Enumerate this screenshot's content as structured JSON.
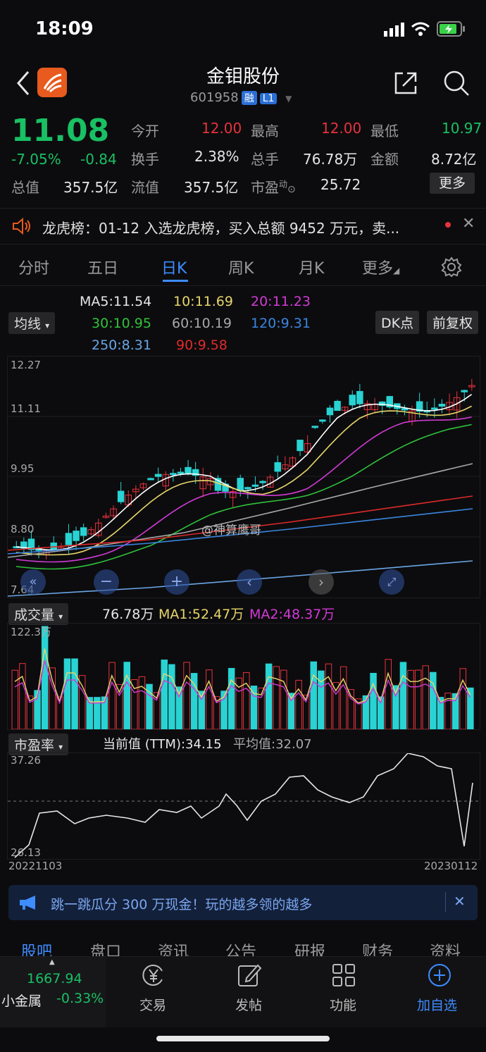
{
  "status_bar": {
    "time": "18:09"
  },
  "header": {
    "title": "金钼股份",
    "code": "601958",
    "tag_rong": "融",
    "tag_l1": "L1"
  },
  "quote": {
    "price": "11.08",
    "change_pct": "-7.05%",
    "change": "-0.84",
    "rows": [
      [
        {
          "label": "今开",
          "value": "12.00",
          "color": "red"
        },
        {
          "label": "最高",
          "value": "12.00",
          "color": "red"
        },
        {
          "label": "最低",
          "value": "10.97",
          "color": "green"
        }
      ],
      [
        {
          "label": "换手",
          "value": "2.38%"
        },
        {
          "label": "总手",
          "value": "76.78万"
        },
        {
          "label": "金额",
          "value": "8.72亿"
        }
      ]
    ],
    "row3": {
      "total_cap_label": "总值",
      "total_cap": "357.5亿",
      "float_cap_label": "流值",
      "float_cap": "357.5亿",
      "pe_label": "市盈",
      "pe_sup": "动",
      "pe": "25.72"
    },
    "more_label": "更多"
  },
  "banner": {
    "text": "龙虎榜：01-12 入选龙虎榜，买入总额 9452 万元，卖..."
  },
  "tabs": [
    {
      "label": "分时"
    },
    {
      "label": "五日"
    },
    {
      "label": "日K"
    },
    {
      "label": "周K"
    },
    {
      "label": "月K"
    },
    {
      "label": "更多"
    }
  ],
  "ma_panel": {
    "selector": "均线",
    "ma5": "MA5:11.54",
    "ma10": "10:11.69",
    "ma20": "20:11.23",
    "ma30": "30:10.95",
    "ma60": "60:10.19",
    "ma120": "120:9.31",
    "ma250": "250:8.31",
    "ma90": "90:9.58",
    "dk_button": "DK点",
    "fq_button": "前复权"
  },
  "kline": {
    "y_labels": [
      "12.27",
      "11.11",
      "9.95",
      "8.80",
      "7.64"
    ],
    "watermark": "@神算鹰哥"
  },
  "volume": {
    "selector": "成交量",
    "vol": "76.78万",
    "ma1": "MA1:52.47万",
    "ma2": "MA2:48.37万",
    "ymax": "122.3万"
  },
  "pe_chart": {
    "selector": "市盈率",
    "current": "当前值 (TTM):34.15",
    "avg": "平均值:32.07",
    "ymax": "37.26",
    "ymin": "26.13",
    "date_start": "20221103",
    "date_end": "20230112"
  },
  "promo": {
    "text": "跳一跳瓜分 300 万现金！玩的越多领的越多"
  },
  "bottom_tabs": [
    {
      "label": "股吧"
    },
    {
      "label": "盘口"
    },
    {
      "label": "资讯"
    },
    {
      "label": "公告"
    },
    {
      "label": "研报"
    },
    {
      "label": "财务"
    },
    {
      "label": "资料"
    }
  ],
  "bottom_bar": {
    "index_value": "1667.94",
    "index_name": "小金属",
    "index_change": "-0.33%",
    "items": [
      {
        "label": "交易"
      },
      {
        "label": "发帖"
      },
      {
        "label": "功能"
      },
      {
        "label": "加自选"
      }
    ]
  },
  "colors": {
    "up": "#e7323c",
    "down": "#29d3d3",
    "accent": "#3e8cff",
    "green": "#19c064"
  }
}
